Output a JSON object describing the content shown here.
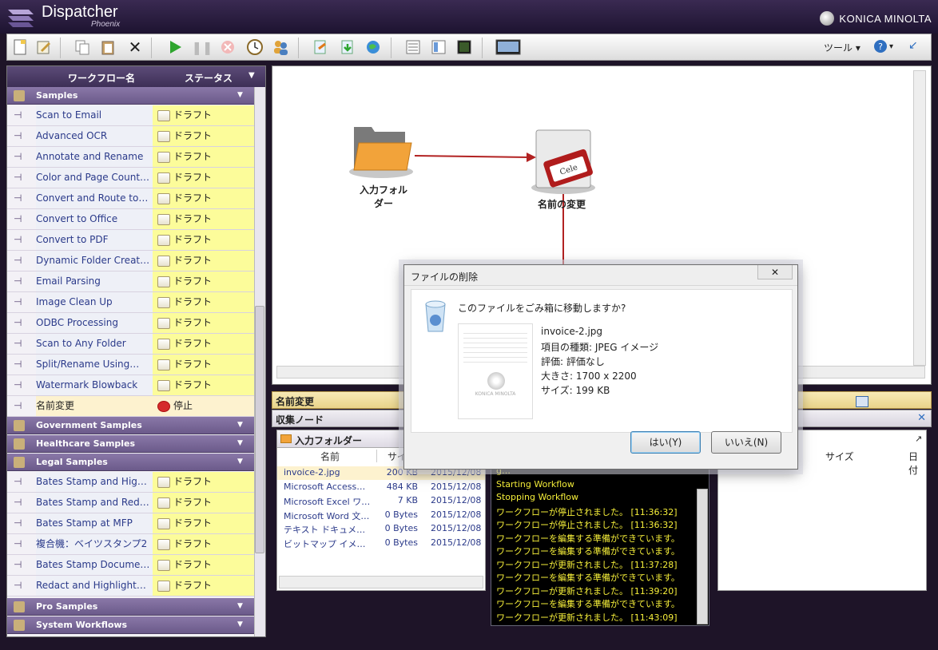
{
  "app": {
    "title": "Dispatcher",
    "subtitle": "Phoenix",
    "brand": "KONICA MINOLTA"
  },
  "toolbar": {
    "tools_label": "ツール ▾",
    "help_label": "? ▾"
  },
  "left_panel": {
    "col_name": "ワークフロー名",
    "col_status": "ステータス",
    "groups": {
      "samples": "Samples",
      "government": "Government Samples",
      "healthcare": "Healthcare Samples",
      "legal": "Legal Samples",
      "pro": "Pro Samples",
      "system": "System Workflows"
    },
    "samples_rows": [
      {
        "name": "Scan to Email",
        "status": "ドラフト"
      },
      {
        "name": "Advanced OCR",
        "status": "ドラフト"
      },
      {
        "name": "Annotate and Rename",
        "status": "ドラフト"
      },
      {
        "name": "Color and Page Count…",
        "status": "ドラフト"
      },
      {
        "name": "Convert and Route to…",
        "status": "ドラフト"
      },
      {
        "name": "Convert to Office",
        "status": "ドラフト"
      },
      {
        "name": "Convert to PDF",
        "status": "ドラフト"
      },
      {
        "name": "Dynamic Folder Creat…",
        "status": "ドラフト"
      },
      {
        "name": "Email Parsing",
        "status": "ドラフト"
      },
      {
        "name": "Image Clean Up",
        "status": "ドラフト"
      },
      {
        "name": "ODBC Processing",
        "status": "ドラフト"
      },
      {
        "name": "Scan to Any Folder",
        "status": "ドラフト"
      },
      {
        "name": "Split/Rename Using…",
        "status": "ドラフト"
      },
      {
        "name": "Watermark Blowback",
        "status": "ドラフト"
      },
      {
        "name": "名前変更",
        "status": "停止"
      }
    ],
    "legal_rows": [
      {
        "name": "Bates Stamp and Hig…",
        "status": "ドラフト"
      },
      {
        "name": "Bates Stamp and Red…",
        "status": "ドラフト"
      },
      {
        "name": "Bates Stamp at MFP",
        "status": "ドラフト"
      },
      {
        "name": "複合機：ベイツスタンプ2",
        "status": "ドラフト"
      },
      {
        "name": "Bates Stamp Docume…",
        "status": "ドラフト"
      },
      {
        "name": "Redact and Highlight…",
        "status": "ドラフト"
      }
    ]
  },
  "canvas": {
    "node_input": [
      "入力フォル",
      "ダー"
    ],
    "node_rename": "名前の変更"
  },
  "bottom": {
    "workflow_title": "名前変更",
    "collect_title": "収集ノード",
    "folder_title": "入力フォルダー",
    "col_name": "名前",
    "col_size": "サイ",
    "right_col_size": "サイズ",
    "right_col_date": "日付",
    "files": [
      {
        "name": "invoice-2.jpg",
        "size": "200 KB",
        "date": "2015/12/08"
      },
      {
        "name": "Microsoft Access…",
        "size": "484 KB",
        "date": "2015/12/08"
      },
      {
        "name": "Microsoft Excel ワ…",
        "size": "7 KB",
        "date": "2015/12/08"
      },
      {
        "name": "Microsoft Word 文…",
        "size": "0 Bytes",
        "date": "2015/12/08"
      },
      {
        "name": "テキスト ドキュメ…",
        "size": "0 Bytes",
        "date": "2015/12/08"
      },
      {
        "name": "ビットマップ イメ…",
        "size": "0 Bytes",
        "date": "2015/12/08"
      }
    ],
    "log": [
      "g…",
      "Starting Workflow",
      "Stopping Workflow",
      "ワークフローが停止されました。 [11:36:32]",
      "ワークフローが停止されました。 [11:36:32]",
      "ワークフローを編集する準備ができています。",
      "ワークフローを編集する準備ができています。",
      "ワークフローが更新されました。 [11:37:28]",
      "ワークフローを編集する準備ができています。",
      "ワークフローが更新されました。 [11:39:20]",
      "ワークフローを編集する準備ができています。",
      "ワークフローが更新されました。 [11:43:09]"
    ]
  },
  "dialog": {
    "title": "ファイルの削除",
    "close": "✕",
    "question": "このファイルをごみ箱に移動しますか?",
    "filename": "invoice-2.jpg",
    "type": "項目の種類: JPEG イメージ",
    "rating": "評価: 評価なし",
    "dimensions": "大きさ: 1700 x 2200",
    "size": "サイズ: 199 KB",
    "thumb_brand": "KONICA MINOLTA",
    "yes": "はい(Y)",
    "no": "いいえ(N)"
  },
  "colors": {
    "accent": "#3d2f56",
    "draft_bg": "#fcfc9a",
    "log_text": "#f6ef3a",
    "connector": "#b22222"
  }
}
